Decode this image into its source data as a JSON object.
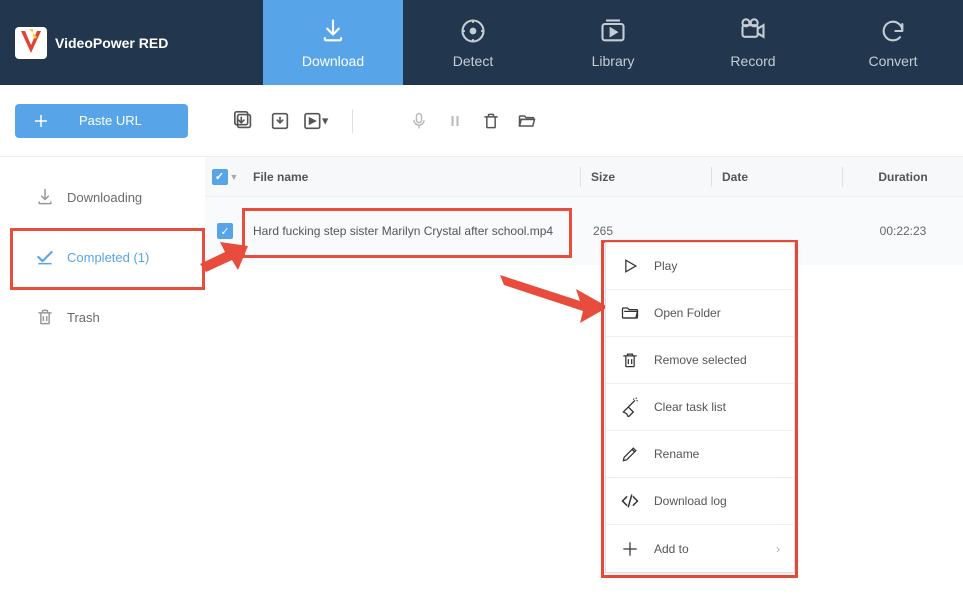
{
  "app": {
    "title": "VideoPower RED"
  },
  "nav": {
    "download": "Download",
    "detect": "Detect",
    "library": "Library",
    "record": "Record",
    "convert": "Convert"
  },
  "toolbar": {
    "paste_url": "Paste URL"
  },
  "sidebar": {
    "downloading": "Downloading",
    "completed": "Completed (1)",
    "trash": "Trash"
  },
  "table": {
    "headers": {
      "filename": "File name",
      "size": "Size",
      "date": "Date",
      "duration": "Duration"
    },
    "rows": [
      {
        "filename": "Hard fucking step sister Marilyn Crystal after school.mp4",
        "size": "265",
        "date": "",
        "duration": "00:22:23"
      }
    ]
  },
  "context_menu": {
    "play": "Play",
    "open_folder": "Open Folder",
    "remove_selected": "Remove selected",
    "clear_task_list": "Clear task list",
    "rename": "Rename",
    "download_log": "Download log",
    "add_to": "Add to"
  }
}
